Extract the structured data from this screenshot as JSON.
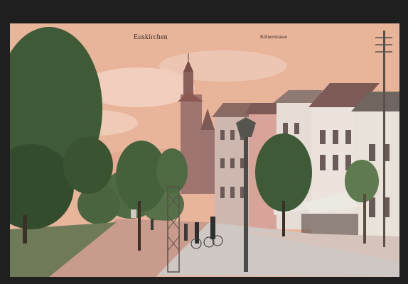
{
  "image": {
    "kind": "hand-tinted vintage postcard",
    "scene": "street with tall church spire, row of townhouses, trees, lamp posts, people with bicycles",
    "colors": {
      "frame": "#1f1f1f",
      "sky": "#e8b49a",
      "cloud": "#f2d5c5",
      "road": "#cfc7c4",
      "sidewalk": "#c99b8c",
      "foliage": "#3f5a36",
      "building_light": "#e6ddd6",
      "building_dark": "#8c6c66",
      "roof": "#7d5a55"
    }
  },
  "caption": {
    "title": "Euskirchen",
    "street": "Kölnerstrasse"
  }
}
